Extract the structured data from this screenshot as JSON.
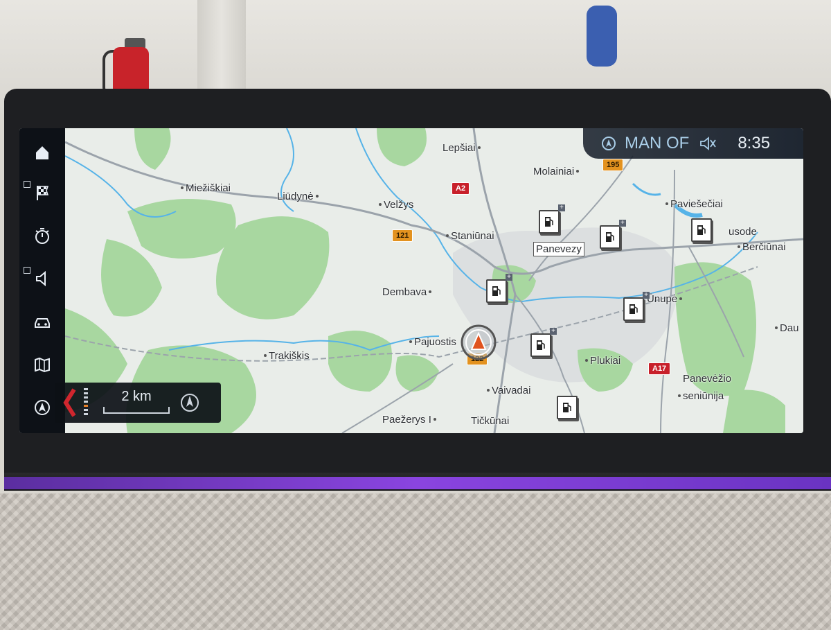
{
  "status_bar": {
    "source": "MAN OF",
    "time": "8:35",
    "icons": [
      "navigation-icon",
      "mute-icon"
    ]
  },
  "sidebar": {
    "items": [
      {
        "name": "home",
        "icon": "home-icon"
      },
      {
        "name": "destination",
        "icon": "checkered-flag-icon"
      },
      {
        "name": "timer",
        "icon": "stopwatch-icon"
      },
      {
        "name": "audio",
        "icon": "speaker-icon"
      },
      {
        "name": "vehicle",
        "icon": "car-icon"
      },
      {
        "name": "map",
        "icon": "map-icon"
      },
      {
        "name": "navigation",
        "icon": "navigation-icon"
      }
    ]
  },
  "map": {
    "places": {
      "lepsiai": "Lepšiai",
      "molainiai": "Molainiai",
      "mieziskiai": "Miežiškiai",
      "liudyne": "Liūdynė",
      "velzys": "Velžys",
      "pavieseciai": "Paviešečiai",
      "staniunai": "Staniūnai",
      "panevezy": "Panevezy",
      "usode": "usode",
      "berciunai": "Berčiūnai",
      "dembava": "Dembava",
      "unupe": "Ūnupė",
      "pajuostis": "Pajuostis",
      "dau": "Dau",
      "trakiskis": "Trakiškis",
      "plukiai": "Plukiai",
      "vaivadai": "Vaivadai",
      "panevezio": "Panevėžio",
      "seniunija": "seniūnija",
      "paezerys": "Paežerys I",
      "tickunai": "Tičkūnai"
    },
    "roads": {
      "a2": "A2",
      "r195": "195",
      "r121": "121",
      "r122": "122",
      "a17": "A17"
    },
    "poi_icon": "fuel-station-icon"
  },
  "scale": {
    "label": "2 km",
    "zoom_icon": "compass-icon"
  },
  "colors": {
    "map_bg": "#e9ede9",
    "forest": "#a8d7a0",
    "water": "#56b3e8",
    "road_orange": "#e3921f",
    "road_red": "#c8202a",
    "sidebar_bg": "#0d1117",
    "status_text": "#a9cde7",
    "ambient": "#8a44e0"
  }
}
